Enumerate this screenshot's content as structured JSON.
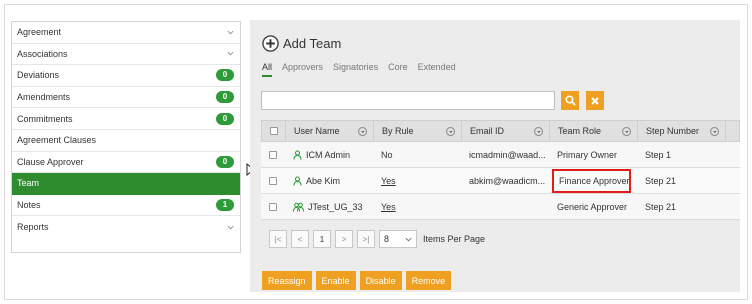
{
  "sidebar": {
    "items": [
      {
        "label": "Agreement",
        "chevron": true
      },
      {
        "label": "Associations",
        "chevron": true
      },
      {
        "label": "Deviations",
        "badge": "0"
      },
      {
        "label": "Amendments",
        "badge": "0"
      },
      {
        "label": "Commitments",
        "badge": "0"
      },
      {
        "label": "Agreement Clauses"
      },
      {
        "label": "Clause Approver",
        "badge": "0"
      },
      {
        "label": "Team",
        "active": true
      },
      {
        "label": "Notes",
        "badge": "1"
      },
      {
        "label": "Reports",
        "chevron": true
      }
    ]
  },
  "main": {
    "title": "Add Team",
    "tabs": [
      "All",
      "Approvers",
      "Signatories",
      "Core",
      "Extended"
    ],
    "search_value": ""
  },
  "grid": {
    "headers": [
      "User Name",
      "By Rule",
      "Email ID",
      "Team Role",
      "Step Number"
    ],
    "rows": [
      {
        "user": "ICM Admin",
        "by_rule": "No",
        "email": "icmadmin@waad...",
        "role": "Primary Owner",
        "step": "Step 1"
      },
      {
        "user": "Abe Kim",
        "by_rule": "Yes",
        "email": "abkim@waadicm...",
        "role": "Finance Approver",
        "step": "Step 21"
      },
      {
        "user": "JTest_UG_33",
        "by_rule": "Yes",
        "email": "",
        "role": "Generic Approver",
        "step": "Step 21"
      }
    ]
  },
  "pager": {
    "first": "|<",
    "prev": "<",
    "page": "1",
    "next": ">",
    "last": ">|",
    "page_size": "8",
    "items_per_page": "Items Per Page"
  },
  "actions": {
    "reassign": "Reassign",
    "enable": "Enable",
    "disable": "Disable",
    "remove": "Remove"
  },
  "colors": {
    "accent_green": "#2e8b2e",
    "badge_green": "#2e9b3a",
    "orange": "#f0a020",
    "highlight_red": "#e21b1b"
  }
}
